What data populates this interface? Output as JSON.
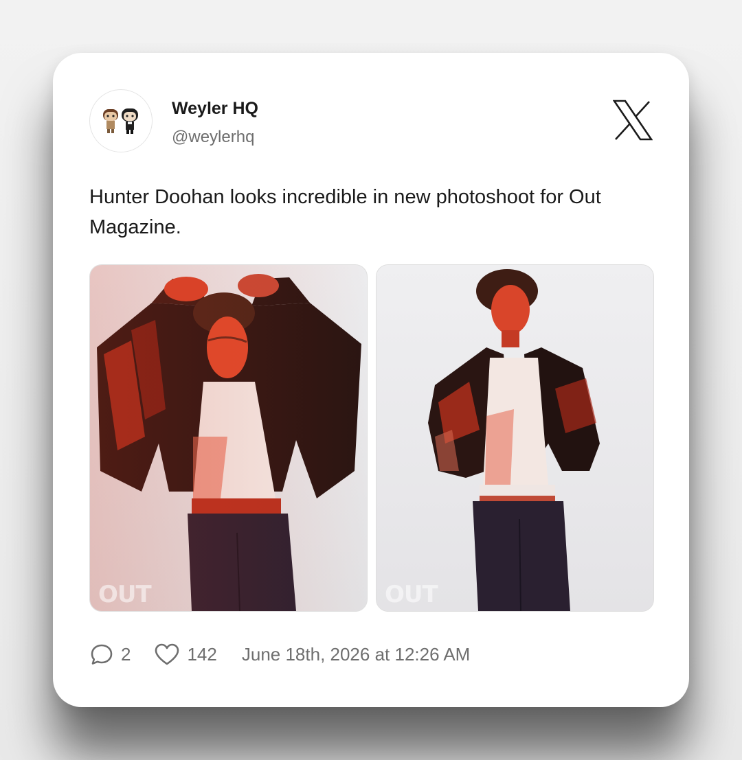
{
  "author": {
    "display_name": "Weyler HQ",
    "handle": "@weylerhq"
  },
  "tweet": {
    "text": "Hunter Doohan looks incredible in new photoshoot for Out Magazine."
  },
  "photos": [
    {
      "watermark": "OUT"
    },
    {
      "watermark": "OUT"
    }
  ],
  "stats": {
    "replies": "2",
    "likes": "142",
    "timestamp": "June 18th, 2026 at 12:26 AM"
  },
  "icons": {
    "brand": "x-logo-icon",
    "reply": "comment-icon",
    "like": "heart-icon"
  },
  "colors": {
    "text_primary": "#1a1a1a",
    "text_secondary": "#6e6e6e",
    "card_background": "#ffffff",
    "photo_accent_red": "#c0321e"
  }
}
